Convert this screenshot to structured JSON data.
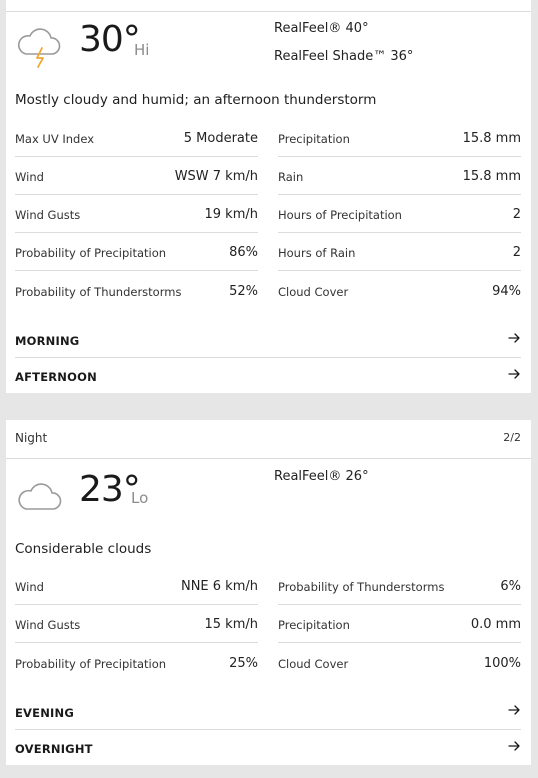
{
  "day": {
    "temperature": "30°",
    "temp_suffix": "Hi",
    "icon": "thunderstorm-cloud-icon",
    "realfeel": "RealFeel® 40°",
    "realfeel_shade": "RealFeel Shade™ 36°",
    "phrase": "Mostly cloudy and humid; an afternoon thunderstorm",
    "left_stats": [
      {
        "label": "Max UV Index",
        "value": "5 Moderate"
      },
      {
        "label": "Wind",
        "value": "WSW 7 km/h"
      },
      {
        "label": "Wind Gusts",
        "value": "19 km/h"
      },
      {
        "label": "Probability of Precipitation",
        "value": "86%"
      },
      {
        "label": "Probability of Thunderstorms",
        "value": "52%"
      }
    ],
    "right_stats": [
      {
        "label": "Precipitation",
        "value": "15.8 mm"
      },
      {
        "label": "Rain",
        "value": "15.8 mm"
      },
      {
        "label": "Hours of Precipitation",
        "value": "2"
      },
      {
        "label": "Hours of Rain",
        "value": "2"
      },
      {
        "label": "Cloud Cover",
        "value": "94%"
      }
    ],
    "links": [
      "MORNING",
      "AFTERNOON"
    ]
  },
  "night": {
    "header": "Night",
    "pager": "2/2",
    "temperature": "23°",
    "temp_suffix": "Lo",
    "icon": "cloud-icon",
    "realfeel": "RealFeel® 26°",
    "phrase": "Considerable clouds",
    "left_stats": [
      {
        "label": "Wind",
        "value": "NNE 6 km/h"
      },
      {
        "label": "Wind Gusts",
        "value": "15 km/h"
      },
      {
        "label": "Probability of Precipitation",
        "value": "25%"
      }
    ],
    "right_stats": [
      {
        "label": "Probability of Thunderstorms",
        "value": "6%"
      },
      {
        "label": "Precipitation",
        "value": "0.0 mm"
      },
      {
        "label": "Cloud Cover",
        "value": "100%"
      }
    ],
    "links": [
      "EVENING",
      "OVERNIGHT"
    ]
  },
  "colors": {
    "background": "#e6e6e6",
    "card": "#ffffff",
    "divider": "#dcdcdc",
    "lightning": "#f0a830",
    "cloud_stroke": "#9a9a9a"
  }
}
